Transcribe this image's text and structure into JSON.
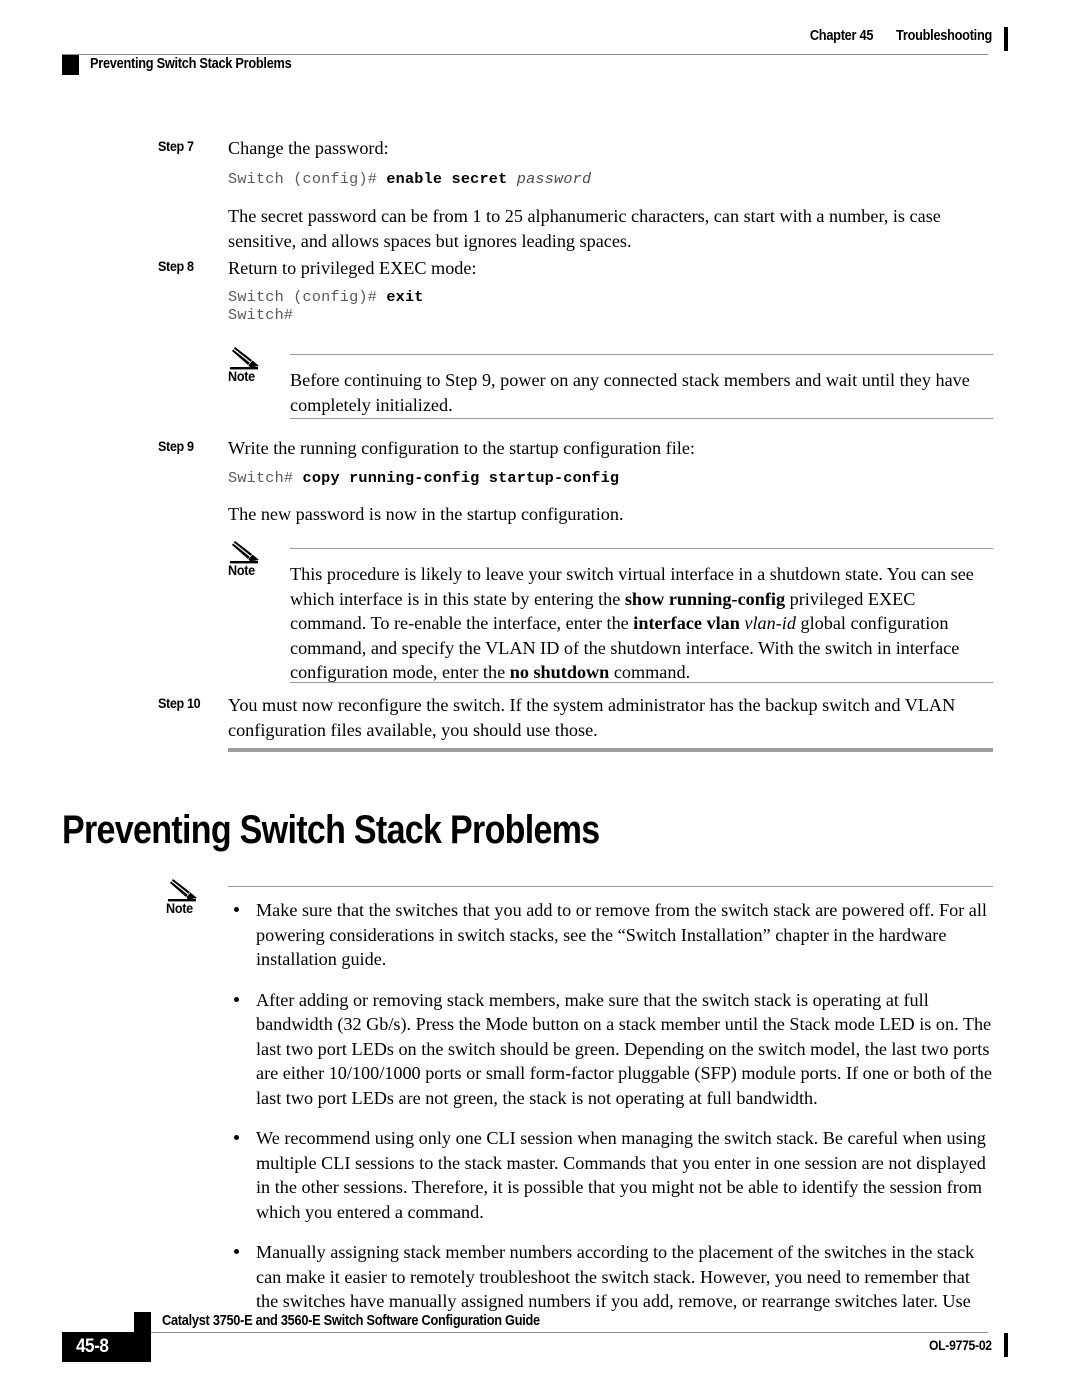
{
  "header": {
    "chapter": "Chapter 45",
    "section": "Troubleshooting",
    "running_head": "Preventing Switch Stack Problems"
  },
  "steps": {
    "step7": {
      "label": "Step 7",
      "text": "Change the password:",
      "code_prompt": "Switch (config)# ",
      "code_command": "enable secret ",
      "code_arg": "password",
      "explanation": "The secret password can be from 1 to 25 alphanumeric characters, can start with a number, is case sensitive, and allows spaces but ignores leading spaces."
    },
    "step8": {
      "label": "Step 8",
      "text": "Return to privileged EXEC mode:",
      "code_prompt": "Switch (config)# ",
      "code_command": "exit",
      "code_line2": "Switch#"
    },
    "step9": {
      "label": "Step 9",
      "text": "Write the running configuration to the startup configuration file:",
      "code_prompt": "Switch# ",
      "code_command": "copy running-config startup-config",
      "explanation": "The new password is now in the startup configuration."
    },
    "step10": {
      "label": "Step 10",
      "text": "You must now reconfigure the switch. If the system administrator has the backup switch and VLAN configuration files available, you should use those."
    }
  },
  "notes": {
    "note1": {
      "label": "Note",
      "text": "Before continuing to Step 9, power on any connected stack members and wait until they have completely initialized."
    },
    "note2": {
      "label": "Note",
      "seg1": "This procedure is likely to leave your switch virtual interface in a shutdown state. You can see which interface is in this state by entering the ",
      "bold1": "show running-config",
      "seg2": " privileged EXEC command. To re-enable the interface, enter the ",
      "bold2": "interface vlan",
      "italic1": " vlan-id",
      "seg3": " global configuration command, and specify the VLAN ID of the shutdown interface. With the switch in interface configuration mode, enter the ",
      "bold3": "no shutdown",
      "seg4": " command."
    },
    "note3": {
      "label": "Note",
      "bullets": [
        "Make sure that the switches that you add to or remove from the switch stack are powered off. For all powering considerations in switch stacks, see the “Switch Installation” chapter in the hardware installation guide.",
        "After adding or removing stack members, make sure that the switch stack is operating at full bandwidth (32 Gb/s). Press the Mode button on a stack member until the Stack mode LED is on. The last two port LEDs on the switch should be green. Depending on the switch model, the last two ports are either 10/100/1000 ports or small form-factor pluggable (SFP) module ports. If one or both of the last two port LEDs are not green, the stack is not operating at full bandwidth.",
        "We recommend using only one CLI session when managing the switch stack. Be careful when using multiple CLI sessions to the stack master. Commands that you enter in one session are not displayed in the other sessions. Therefore, it is possible that you might not be able to identify the session from which you entered a command.",
        "Manually assigning stack member numbers according to the placement of the switches in the stack can make it easier to remotely troubleshoot the switch stack. However, you need to remember that the switches have manually assigned numbers if you add, remove, or rearrange switches later. Use"
      ]
    }
  },
  "section_heading": "Preventing Switch Stack Problems",
  "footer": {
    "guide_title": "Catalyst 3750-E and 3560-E Switch Software Configuration Guide",
    "page_number": "45-8",
    "doc_number": "OL-9775-02"
  }
}
